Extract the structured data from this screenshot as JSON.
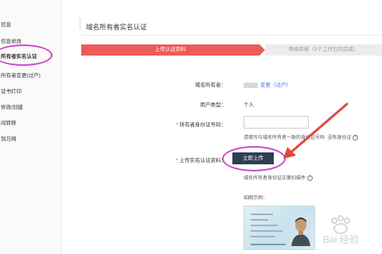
{
  "sidebar": {
    "items": [
      {
        "label": "信息"
      },
      {
        "label": "信息修改"
      },
      {
        "label": "所有者实名认证"
      },
      {
        "label": "所有者变更(过户)"
      },
      {
        "label": "证书打印"
      },
      {
        "label": "修改/创建"
      },
      {
        "label": "间转移"
      },
      {
        "label": "到万网"
      }
    ]
  },
  "main": {
    "title": "域名所有者实名认证",
    "steps": [
      {
        "label": "上传认证资料"
      },
      {
        "label": "等待审核（2个工作日内完成）"
      }
    ],
    "owner_label": "域名所有者：",
    "owner_change": "变更",
    "owner_transfer": "（过户）",
    "user_type_label": "用户类型：",
    "user_type_value": "个人",
    "id_label": "所有者身份证号码：",
    "id_input_value": "",
    "id_hint": "请填写与域名所有者一致的身份证号码",
    "id_hint_link": "没有身份证",
    "upload_label": "上传实名认证资料：",
    "upload_button": "立即上传",
    "upload_hint": "域名所有者身份证正面扫描件",
    "example_label": "如图示例：",
    "watermark": "Bai 经验"
  },
  "colors": {
    "accent": "#ed5b59",
    "button": "#2f3e52",
    "annotation": "#c84bc9",
    "arrow": "#e0483e"
  }
}
